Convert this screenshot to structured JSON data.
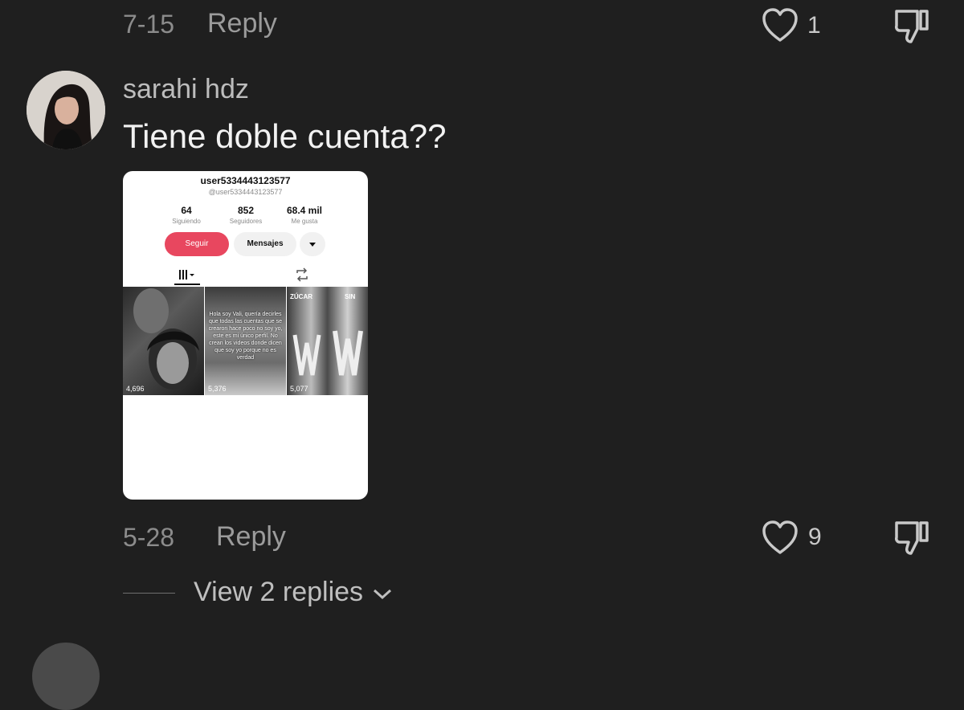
{
  "previous_comment": {
    "date": "7-15",
    "reply_label": "Reply",
    "like_count": "1"
  },
  "comment": {
    "username": "sarahi hdz",
    "text": "Tiene doble cuenta??",
    "date": "5-28",
    "reply_label": "Reply",
    "like_count": "9",
    "view_replies_label": "View 2 replies"
  },
  "screenshot_card": {
    "profile_name": "user5334443123577",
    "profile_handle": "@user5334443123577",
    "stats": [
      {
        "value": "64",
        "label": "Siguiendo"
      },
      {
        "value": "852",
        "label": "Seguidores"
      },
      {
        "value": "68.4 mil",
        "label": "Me gusta"
      }
    ],
    "follow_label": "Seguir",
    "message_label": "Mensajes",
    "videos": [
      {
        "views": "4,696"
      },
      {
        "views": "5,376",
        "overlay_text": "Hola soy Vali, quería decirles que todas las cuentas que se crearon hace poco no soy yo, este es mi único perfil. No crean los videos donde dicen que soy yo porque no es verdad"
      },
      {
        "views": "5,077",
        "brand_text_1": "ZÚCAR",
        "brand_text_2": "SIN"
      }
    ]
  },
  "icons": {
    "like": "heart-outline-icon",
    "dislike": "thumbs-down-outline-icon",
    "expand": "chevron-down-icon"
  },
  "colors": {
    "background": "#1f1f1f",
    "follow_button": "#e8475f"
  }
}
